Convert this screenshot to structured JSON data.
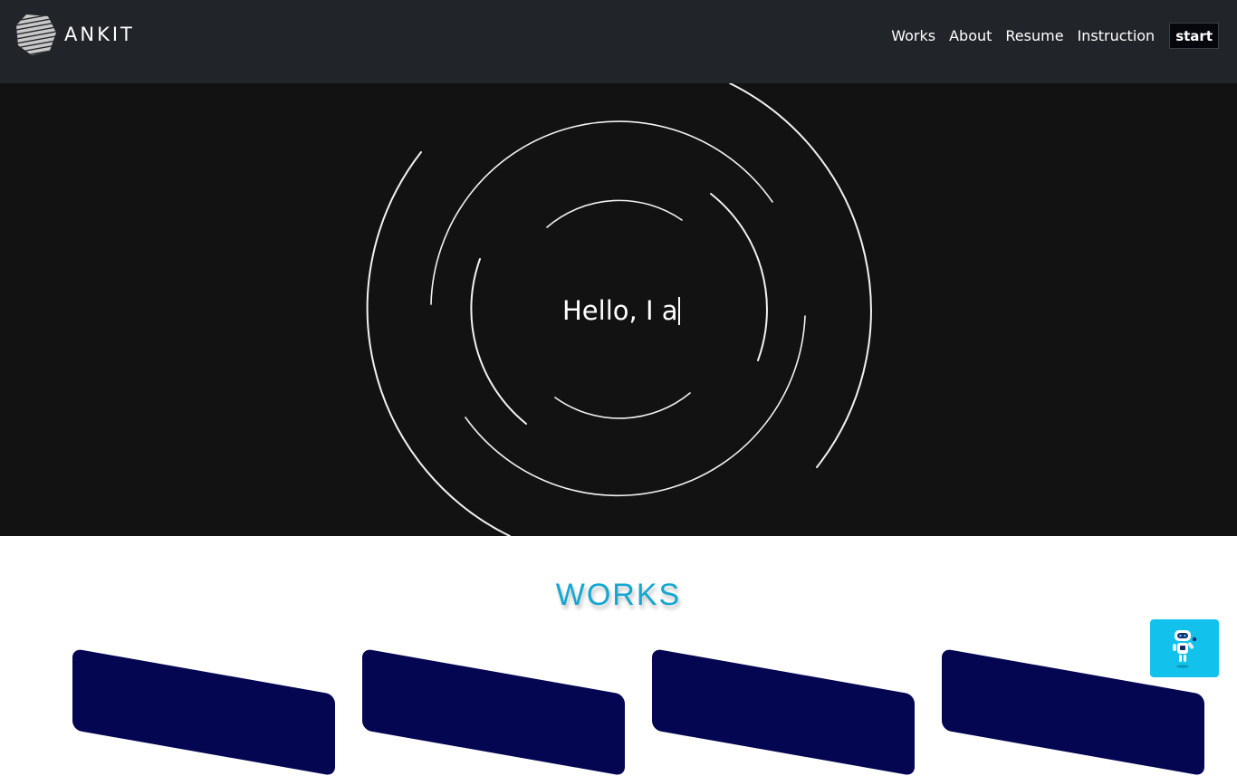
{
  "header": {
    "logo_text": "ANKIT",
    "nav": [
      "Works",
      "About",
      "Resume",
      "Instruction"
    ],
    "start_label": "start"
  },
  "hero": {
    "typed_text": "Hello, I a"
  },
  "works": {
    "title": "WORKS"
  },
  "icons": [
    "logo-mark",
    "chatbot-robot-icon"
  ],
  "colors": {
    "navbar_bg": "#212429",
    "hero_bg": "#121212",
    "works_title": "#13a7d1",
    "card_bg": "#050652",
    "chatbot_bg": "#12c2ec"
  }
}
